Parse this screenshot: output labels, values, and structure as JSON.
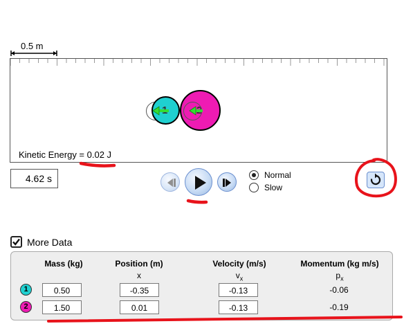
{
  "scale": {
    "label": "0.5 m"
  },
  "play_area": {
    "kinetic_energy": "Kinetic Energy = 0.02 J",
    "balls": [
      {
        "number": "1",
        "color": "#1fd0d0"
      },
      {
        "number": "2",
        "color": "#ee1bb3"
      }
    ]
  },
  "time": {
    "value": "4.62 s"
  },
  "speed": {
    "normal_label": "Normal",
    "slow_label": "Slow",
    "selected": "Normal"
  },
  "more_data": {
    "label": "More Data",
    "checked": true
  },
  "table": {
    "headers": {
      "mass": "Mass (kg)",
      "position": "Position (m)",
      "position_sub": "x",
      "velocity": "Velocity (m/s)",
      "velocity_sub": "v",
      "velocity_sub_index": "x",
      "momentum": "Momentum (kg m/s)",
      "momentum_sub": "p",
      "momentum_sub_index": "x"
    },
    "rows": [
      {
        "icon": "1",
        "mass": "0.50",
        "position": "-0.35",
        "velocity": "-0.13",
        "momentum": "-0.06"
      },
      {
        "icon": "2",
        "mass": "1.50",
        "position": "0.01",
        "velocity": "-0.13",
        "momentum": "-0.19"
      }
    ]
  },
  "colors": {
    "annotation": "#e8131b",
    "ball1": "#1fd0d0",
    "ball2": "#ee1bb3",
    "arrow": "#33dd33"
  }
}
